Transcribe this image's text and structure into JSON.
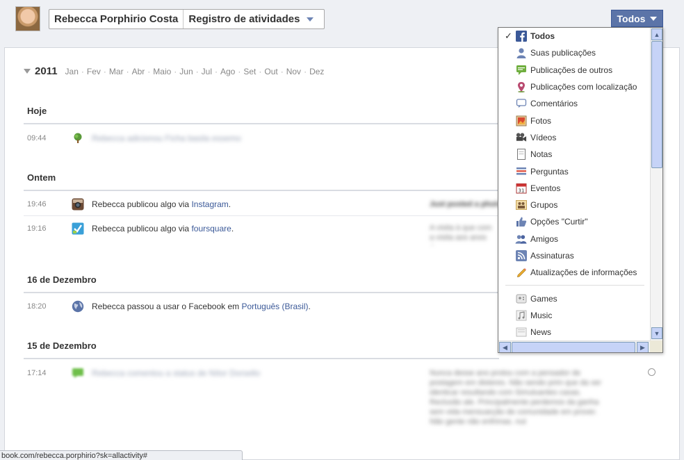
{
  "header": {
    "user_name": "Rebecca Porphirio Costa",
    "section": "Registro de atividades",
    "filter_button": "Todos"
  },
  "timeline": {
    "year": "2011",
    "months": [
      "Jan",
      "Fev",
      "Mar",
      "Abr",
      "Maio",
      "Jun",
      "Jul",
      "Ago",
      "Set",
      "Out",
      "Nov",
      "Dez"
    ],
    "sections": [
      {
        "title": "Hoje",
        "rows": [
          {
            "time": "09:44",
            "icon": "tree-icon",
            "text": "Rebecca adicionou Ficha basila essemo",
            "blurred": true
          }
        ]
      },
      {
        "title": "Ontem",
        "rows": [
          {
            "time": "19:46",
            "icon": "instagram-icon",
            "text": "Rebecca publicou algo via ",
            "link": "Instagram",
            "suffix": ".",
            "side_blur": "Just posted a photo"
          },
          {
            "time": "19:16",
            "icon": "foursquare-icon",
            "text": "Rebecca publicou algo via ",
            "link": "foursquare",
            "suffix": ".",
            "side_blur": "A visita à que com a visita aos anos 4rcomas"
          }
        ]
      },
      {
        "title": "16 de Dezembro",
        "rows": [
          {
            "time": "18:20",
            "icon": "globe-icon",
            "text": "Rebecca passou a usar o Facebook em ",
            "link": "Português (Brasil)",
            "suffix": "."
          }
        ]
      },
      {
        "title": "15 de Dezembro",
        "rows": [
          {
            "time": "17:14",
            "icon": "comment-icon",
            "text": "Rebecca comentou a status de Nítor Dorsello",
            "blurred": true,
            "side_blur": "Nunca desse ano protou com a pensador de postagem em disteres. Não sendo prim que da ver identicar resultando com Simuluantes caxas. Reclusão ale. Principalmente perdemos da ganha sem vida mensuarção de comunidade em prover. Não gente não enfrimas. nut"
          }
        ]
      }
    ]
  },
  "dropdown": {
    "items": [
      {
        "label": "Todos",
        "icon": "facebook-icon",
        "selected": true
      },
      {
        "label": "Suas publicações",
        "icon": "person-icon"
      },
      {
        "label": "Publicações de outros",
        "icon": "speech-green-icon"
      },
      {
        "label": "Publicações com localização",
        "icon": "location-pin-icon"
      },
      {
        "label": "Comentários",
        "icon": "comment-bubble-icon"
      },
      {
        "label": "Fotos",
        "icon": "photo-icon"
      },
      {
        "label": "Vídeos",
        "icon": "video-camera-icon"
      },
      {
        "label": "Notas",
        "icon": "note-icon"
      },
      {
        "label": "Perguntas",
        "icon": "question-list-icon"
      },
      {
        "label": "Eventos",
        "icon": "calendar-icon"
      },
      {
        "label": "Grupos",
        "icon": "group-icon"
      },
      {
        "label": "Opções \"Curtir\"",
        "icon": "thumbs-up-icon"
      },
      {
        "label": "Amigos",
        "icon": "friends-icon"
      },
      {
        "label": "Assinaturas",
        "icon": "rss-icon"
      },
      {
        "label": "Atualizações de informações",
        "icon": "pencil-icon"
      }
    ],
    "apps": [
      {
        "label": "Games",
        "icon": "games-icon"
      },
      {
        "label": "Music",
        "icon": "music-icon"
      },
      {
        "label": "News",
        "icon": "news-icon"
      }
    ],
    "check_mark": "✓"
  },
  "statusbar": {
    "url": "book.com/rebecca.porphirio?sk=allactivity#"
  },
  "colors": {
    "link": "#3b5998",
    "button_bg": "#5b74a8",
    "scroll": "#c6d3f7"
  }
}
